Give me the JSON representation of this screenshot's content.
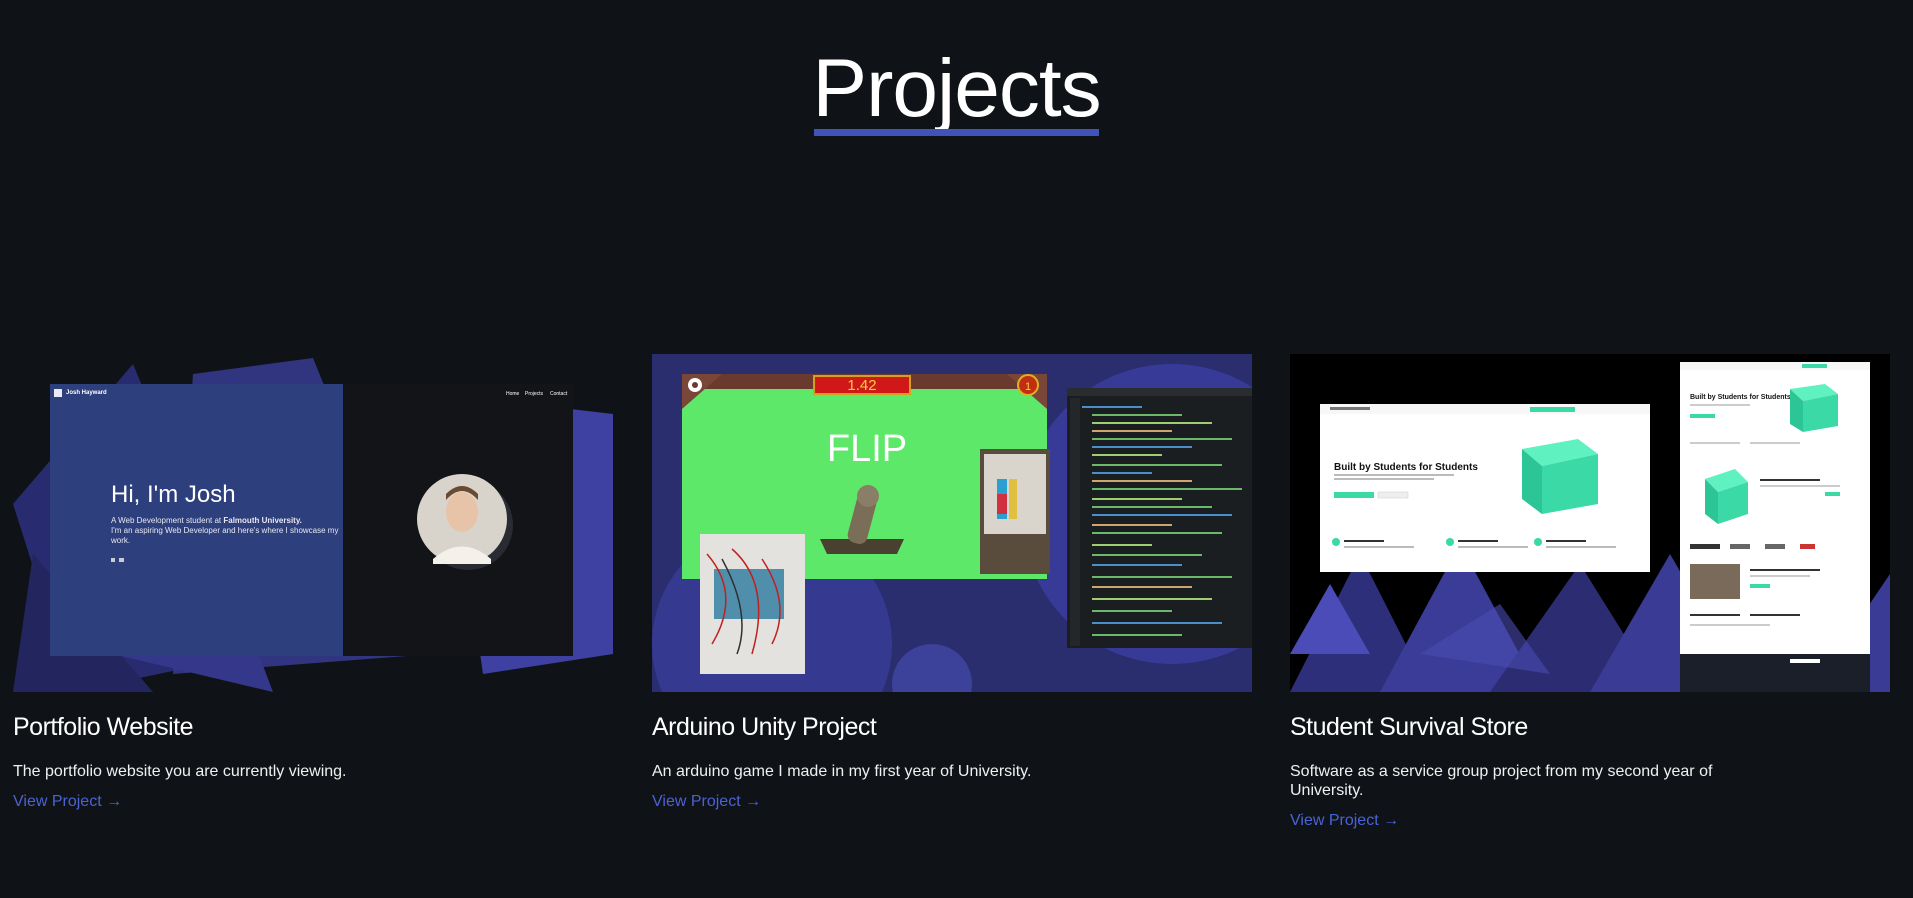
{
  "page": {
    "title": "Projects"
  },
  "projects": [
    {
      "title": "Portfolio Website",
      "description": "The portfolio website you are currently viewing.",
      "link": "View Project →",
      "thumbnail": {
        "brand": "Josh Hayward",
        "nav": [
          "Home",
          "Projects",
          "Contact"
        ],
        "heading": "Hi, I'm Josh",
        "line1_prefix": "A Web Development student at ",
        "line1_bold": "Falmouth University.",
        "line2": "I'm an aspiring Web Developer and here's where I showcase my",
        "line3": "work."
      }
    },
    {
      "title": "Arduino Unity Project",
      "description": "An arduino game I made in my first year of University.",
      "link": "View Project →",
      "thumbnail": {
        "timer": "1.42",
        "counter": "1",
        "action": "FLIP"
      }
    },
    {
      "title": "Student Survival Store",
      "description": "Software as a service group project from my second year of University.",
      "link": "View Project →",
      "thumbnail": {
        "hero": "Built by Students for Students",
        "hero_small": "Built by Students for Students"
      }
    }
  ],
  "colors": {
    "background": "#0f1317",
    "accent": "#3f53b8",
    "link": "#4b62d6",
    "game_green": "#5ee86a",
    "store_green": "#3ad9a6"
  }
}
